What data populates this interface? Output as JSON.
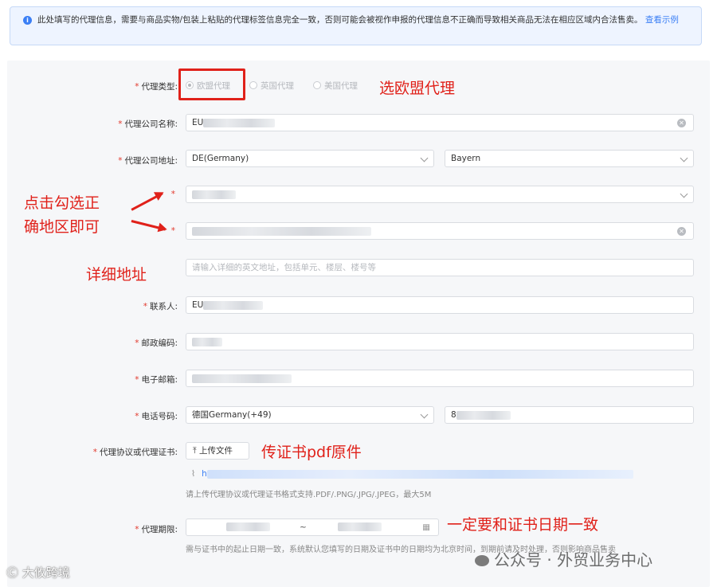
{
  "notice": {
    "text": "此处填写的代理信息，需要与商品实物/包装上粘贴的代理标签信息完全一致，否则可能会被视作申报的代理信息不正确而导致相关商品无法在相应区域内合法售卖。",
    "link": "查看示例"
  },
  "form": {
    "agent_type": {
      "label": "代理类型",
      "options": [
        "欧盟代理",
        "英国代理",
        "美国代理"
      ],
      "selected": "欧盟代理"
    },
    "company_name": {
      "label": "代理公司名称",
      "value": "EU"
    },
    "company_address": {
      "label": "代理公司地址",
      "country": "DE(Germany)",
      "state": "Bayern"
    },
    "city": {
      "value": ""
    },
    "street": {
      "value": ""
    },
    "detail_address": {
      "placeholder": "请输入详细的英文地址，包括单元、楼层、楼号等"
    },
    "contact": {
      "label": "联系人",
      "value": "EU"
    },
    "postcode": {
      "label": "邮政编码",
      "value": ""
    },
    "email": {
      "label": "电子邮箱",
      "value": ""
    },
    "phone": {
      "label": "电话号码",
      "country_code": "德国Germany(+49)",
      "number": "8"
    },
    "certificate": {
      "label": "代理协议或代理证书",
      "upload_label": "上传文件",
      "file_link": "h",
      "hint": "请上传代理协议或代理证书格式支持.PDF/.PNG/.JPG/.JPEG，最大5M"
    },
    "period": {
      "label": "代理期限",
      "separator": "~",
      "hint": "需与证书中的起止日期一致，系统默认您填写的日期及证书中的日期均为北京时间，到期前请及时处理，否则影响商品售卖"
    }
  },
  "annotations": {
    "choose_eu": "选欧盟代理",
    "click_region_line1": "点击勾选正",
    "click_region_line2": "确地区即可",
    "detail_address": "详细地址",
    "upload_pdf": "传证书pdf原件",
    "date_match": "一定要和证书日期一致"
  },
  "watermarks": {
    "left": "大攸跨境",
    "right": "公众号 · 外贸业务中心"
  },
  "colors": {
    "annotation_red": "#e0211a",
    "link_blue": "#3b7ff5",
    "required_red": "#e23a2e"
  }
}
